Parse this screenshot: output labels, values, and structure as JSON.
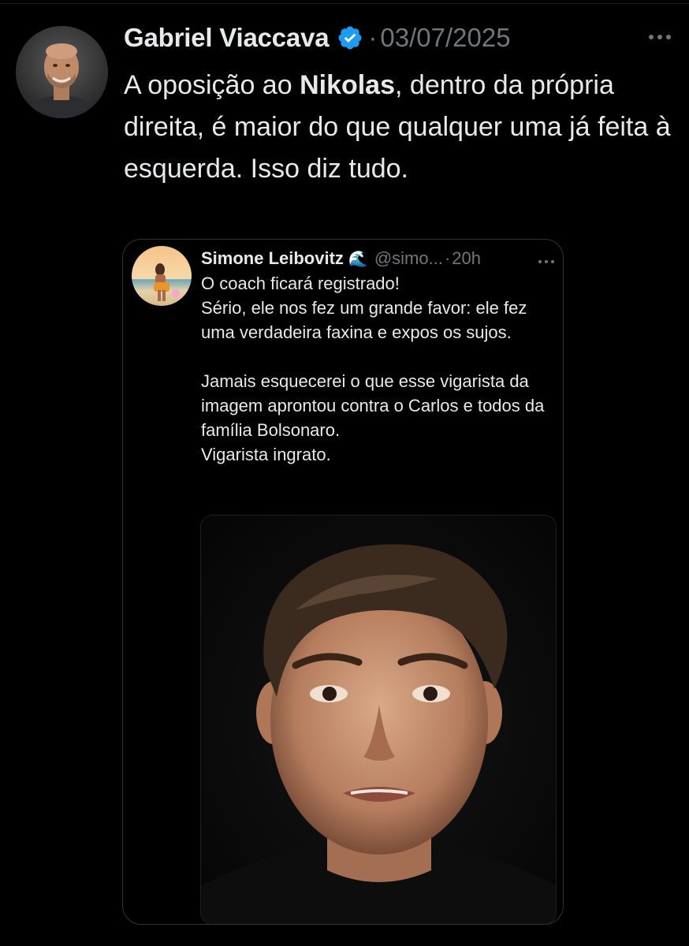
{
  "main_tweet": {
    "author_name": "Gabriel Viaccava",
    "verified": true,
    "separator": "·",
    "date": "03/07/2025",
    "text_before": "A oposição ao ",
    "text_bold": "Nikolas",
    "text_after": ", dentro da própria direita, é maior do que qualquer uma já feita à esquerda. Isso diz tudo."
  },
  "quoted_tweet": {
    "author_name": "Simone Leibovitz",
    "name_emoji": "🌊",
    "handle": "@simo...",
    "separator": "·",
    "time": "20h",
    "paragraph_1": [
      "O coach ficará registrado!",
      "Sério, ele nos fez um grande favor: ele fez uma verdadeira faxina e expos os sujos."
    ],
    "paragraph_2": [
      "Jamais esquecerei o que esse vigarista da imagem aprontou contra o Carlos e todos da família  Bolsonaro.",
      "Vigarista  ingrato."
    ]
  },
  "icons": {
    "verified": "verified-badge-icon",
    "more": "more-options-icon",
    "wave": "wave-emoji"
  },
  "colors": {
    "background": "#000000",
    "text_primary": "#e7e9ea",
    "text_secondary": "#71767b",
    "verified_blue": "#1d9bf0",
    "border": "#2f3336"
  }
}
